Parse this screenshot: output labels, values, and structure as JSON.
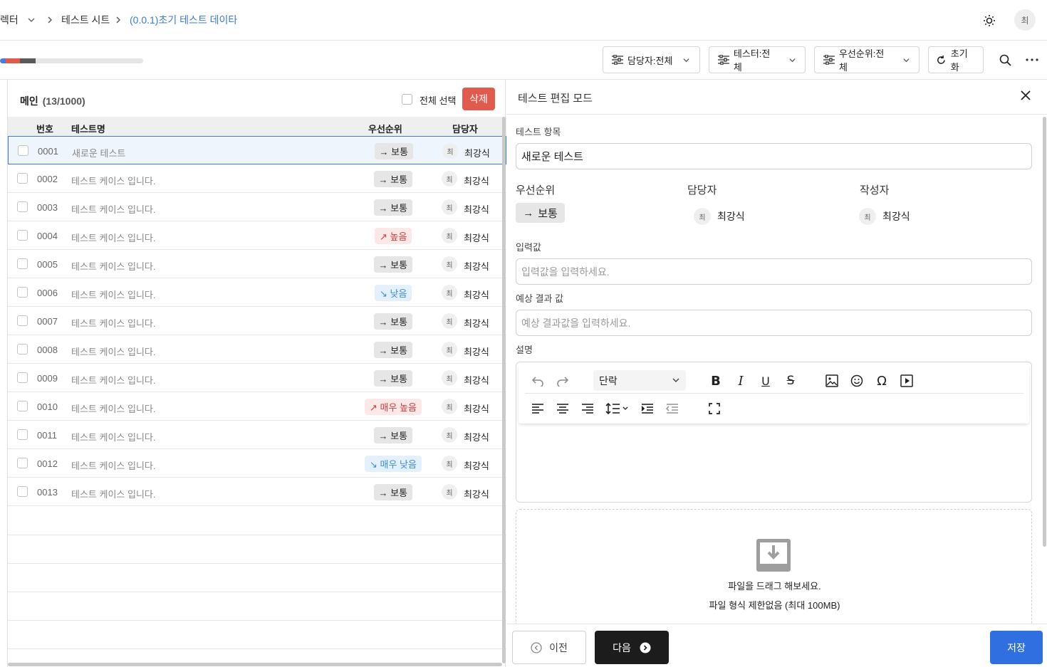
{
  "breadcrumb": {
    "item1": "렉터",
    "item2": "테스트 시트",
    "item3": "(0.0.1)초기 테스트 데이타"
  },
  "user": {
    "avatar": "최"
  },
  "progress": {
    "segments": [
      {
        "color": "#4a7cd9",
        "fraction": 0.04
      },
      {
        "color": "#e05a4e",
        "fraction": 0.1
      },
      {
        "color": "#5a5a5a",
        "fraction": 0.1
      }
    ]
  },
  "filters": {
    "owner": "담당자:전체",
    "tester": "테스터:전체",
    "priority": "우선순위:전체",
    "reset": "초기화"
  },
  "list": {
    "title": "메인",
    "count": "(13/1000)",
    "select_all": "전체 선택",
    "delete": "삭제",
    "columns": {
      "num": "번호",
      "name": "테스트명",
      "priority": "우선순위",
      "owner": "담당자"
    },
    "rows": [
      {
        "num": "0001",
        "name": "새로운 테스트",
        "priority": "→ 보통",
        "level": "normal",
        "avatar": "최",
        "owner": "최강식"
      },
      {
        "num": "0002",
        "name": "테스트 케이스 입니다.",
        "priority": "→ 보통",
        "level": "normal",
        "avatar": "최",
        "owner": "최강식"
      },
      {
        "num": "0003",
        "name": "테스트 케이스 입니다.",
        "priority": "→ 보통",
        "level": "normal",
        "avatar": "최",
        "owner": "최강식"
      },
      {
        "num": "0004",
        "name": "테스트 케이스 입니다.",
        "priority": "↗ 높음",
        "level": "high",
        "avatar": "최",
        "owner": "최강식"
      },
      {
        "num": "0005",
        "name": "테스트 케이스 입니다.",
        "priority": "→ 보통",
        "level": "normal",
        "avatar": "최",
        "owner": "최강식"
      },
      {
        "num": "0006",
        "name": "테스트 케이스 입니다.",
        "priority": "↘ 낮음",
        "level": "low",
        "avatar": "최",
        "owner": "최강식"
      },
      {
        "num": "0007",
        "name": "테스트 케이스 입니다.",
        "priority": "→ 보통",
        "level": "normal",
        "avatar": "최",
        "owner": "최강식"
      },
      {
        "num": "0008",
        "name": "테스트 케이스 입니다.",
        "priority": "→ 보통",
        "level": "normal",
        "avatar": "최",
        "owner": "최강식"
      },
      {
        "num": "0009",
        "name": "테스트 케이스 입니다.",
        "priority": "→ 보통",
        "level": "normal",
        "avatar": "최",
        "owner": "최강식"
      },
      {
        "num": "0010",
        "name": "테스트 케이스 입니다.",
        "priority": "↗ 매우 높음",
        "level": "high",
        "avatar": "최",
        "owner": "최강식"
      },
      {
        "num": "0011",
        "name": "테스트 케이스 입니다.",
        "priority": "→ 보통",
        "level": "normal",
        "avatar": "최",
        "owner": "최강식"
      },
      {
        "num": "0012",
        "name": "테스트 케이스 입니다.",
        "priority": "↘ 매우 낮음",
        "level": "low",
        "avatar": "최",
        "owner": "최강식"
      },
      {
        "num": "0013",
        "name": "테스트 케이스 입니다.",
        "priority": "→ 보통",
        "level": "normal",
        "avatar": "최",
        "owner": "최강식"
      }
    ]
  },
  "editor": {
    "title": "테스트 편집 모드",
    "item_label": "테스트 항목",
    "item_value": "새로운 테스트",
    "priority_label": "우선순위",
    "priority_value": "보통",
    "owner_label": "담당자",
    "owner_avatar": "최",
    "owner_name": "최강식",
    "author_label": "작성자",
    "author_avatar": "최",
    "author_name": "최강식",
    "input_label": "입력값",
    "input_placeholder": "입력값을 입력하세요.",
    "expected_label": "예상 결과 값",
    "expected_placeholder": "예상 결과값을 입력하세요.",
    "desc_label": "설명",
    "paragraph_select": "단락",
    "dropzone_text": "파일을 드래그 해보세요.",
    "dropzone_limit": "파일 형식 제한없음 (최대 100MB)",
    "prev": "이전",
    "next": "다음",
    "save": "저장"
  }
}
